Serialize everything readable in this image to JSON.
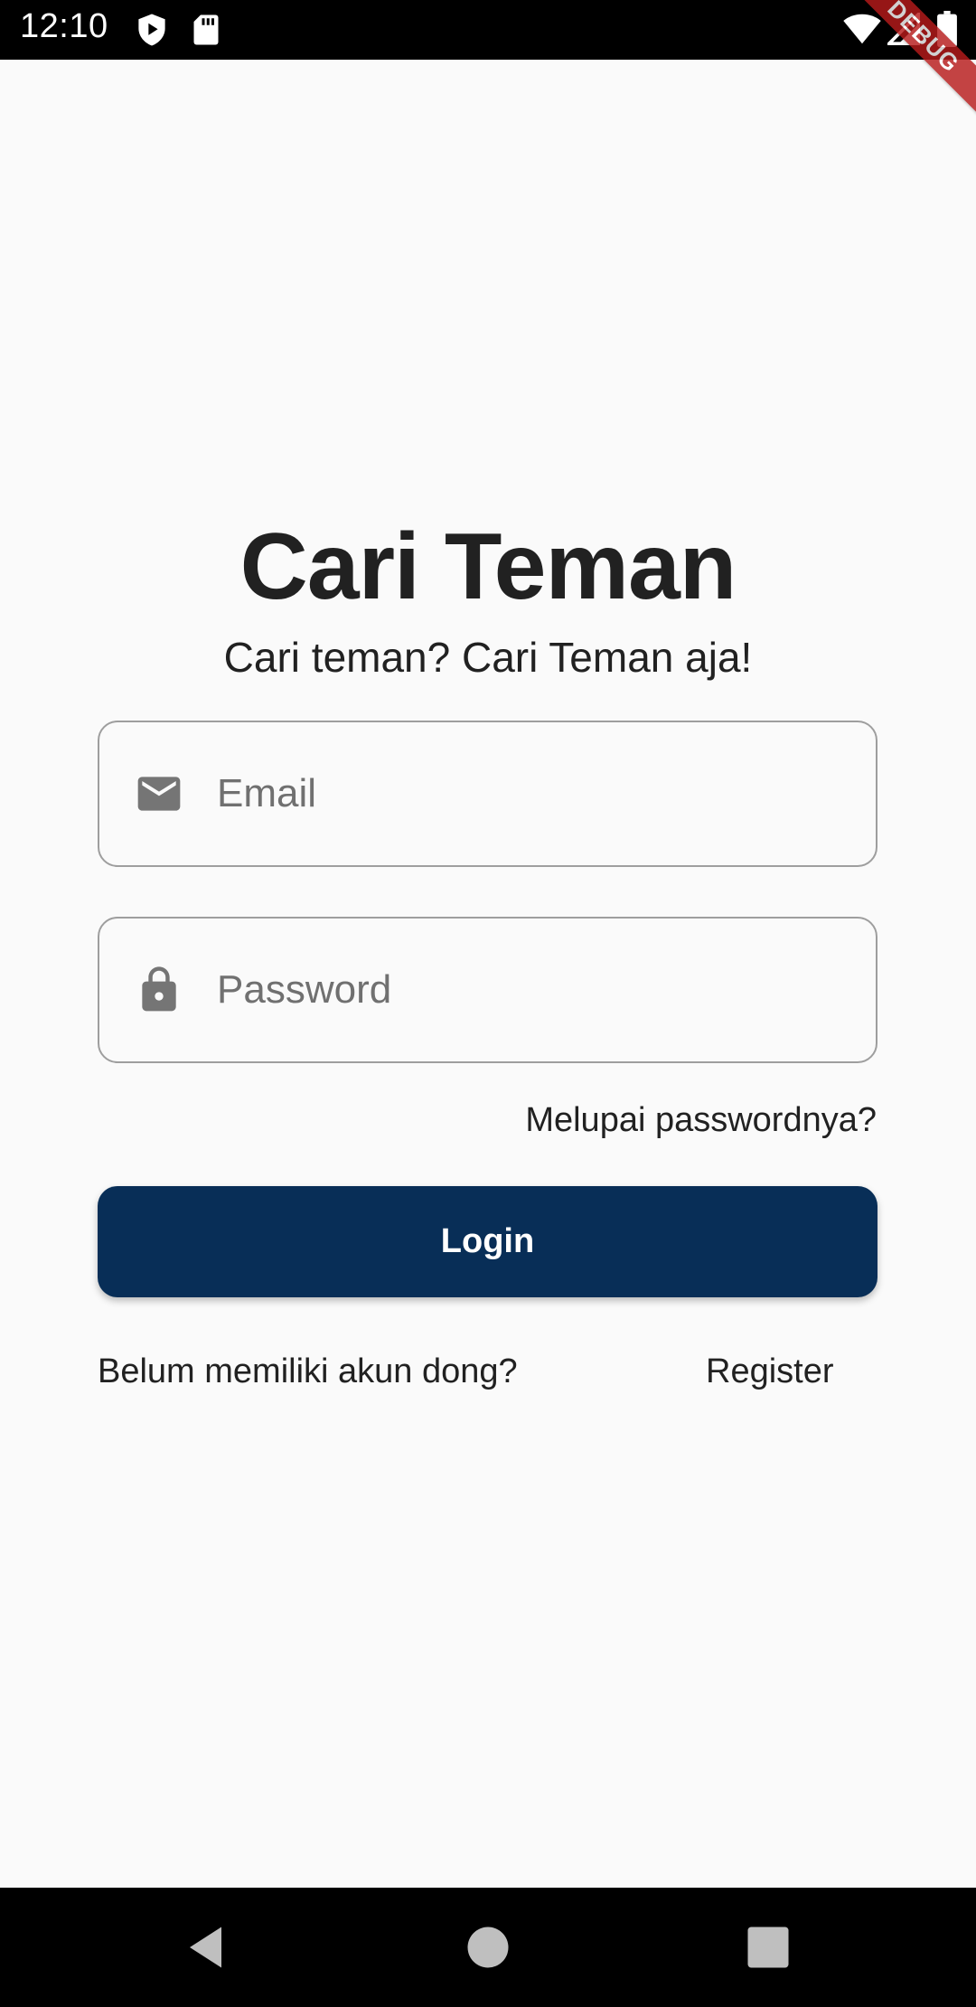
{
  "status_bar": {
    "time": "12:10",
    "icons": [
      "shield-play-icon",
      "sd-card-icon",
      "wifi-icon",
      "signal-icon",
      "battery-icon"
    ]
  },
  "debug_banner": {
    "label": "DEBUG",
    "color": "#b71c1c"
  },
  "login_screen": {
    "title": "Cari Teman",
    "subtitle": "Cari teman? Cari Teman aja!",
    "email_field": {
      "placeholder": "Email",
      "value": "",
      "icon": "mail-icon"
    },
    "password_field": {
      "placeholder": "Password",
      "value": "",
      "icon": "lock-icon"
    },
    "forgot_password": "Melupai passwordnya?",
    "login_button": "Login",
    "no_account_text": "Belum memiliki akun dong?",
    "register_link": "Register"
  },
  "colors": {
    "primary": "#082e57",
    "background": "#fafafa",
    "text": "#212121",
    "field_border": "#9e9e9e",
    "icon": "#757575"
  },
  "nav_bar": {
    "buttons": [
      "back-icon",
      "home-icon",
      "recents-icon"
    ]
  }
}
